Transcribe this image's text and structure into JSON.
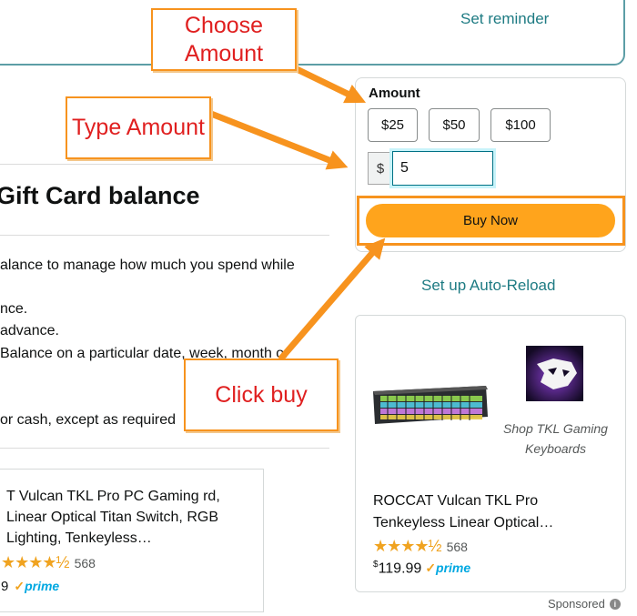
{
  "reminder": {
    "link": "Set reminder"
  },
  "left": {
    "title": "Gift Card balance",
    "lines": [
      "alance to manage how much you spend while",
      "nce.",
      "advance.",
      "Balance on a particular date, week, month or",
      "or cash, except as required"
    ],
    "product": {
      "title": "T Vulcan TKL Pro PC Gaming rd, Linear Optical Titan Switch, RGB Lighting, Tenkeyless…",
      "rating_count": "568",
      "price": "9",
      "prime": "prime"
    }
  },
  "amount": {
    "label": "Amount",
    "presets": [
      "$25",
      "$50",
      "$100"
    ],
    "currency": "$",
    "input_value": "5",
    "buy_button": "Buy Now"
  },
  "auto_reload": "Set up Auto-Reload",
  "ad": {
    "title": "ROCCAT Vulcan TKL Pro Tenkeyless Linear Optical…",
    "rating_count": "568",
    "price_symbol": "$",
    "price": "119.99",
    "prime": "prime",
    "shop_text": "Shop TKL Gaming Keyboards",
    "sponsored": "Sponsored",
    "rating_value": 4.5
  },
  "annotations": {
    "choose_amount": "Choose Amount",
    "type_amount": "Type Amount",
    "click_buy": "Click buy"
  },
  "colors": {
    "callout_border": "#f7931e",
    "callout_text": "#e02020",
    "buy_button": "#ffa41c",
    "link": "#1e7b83"
  }
}
